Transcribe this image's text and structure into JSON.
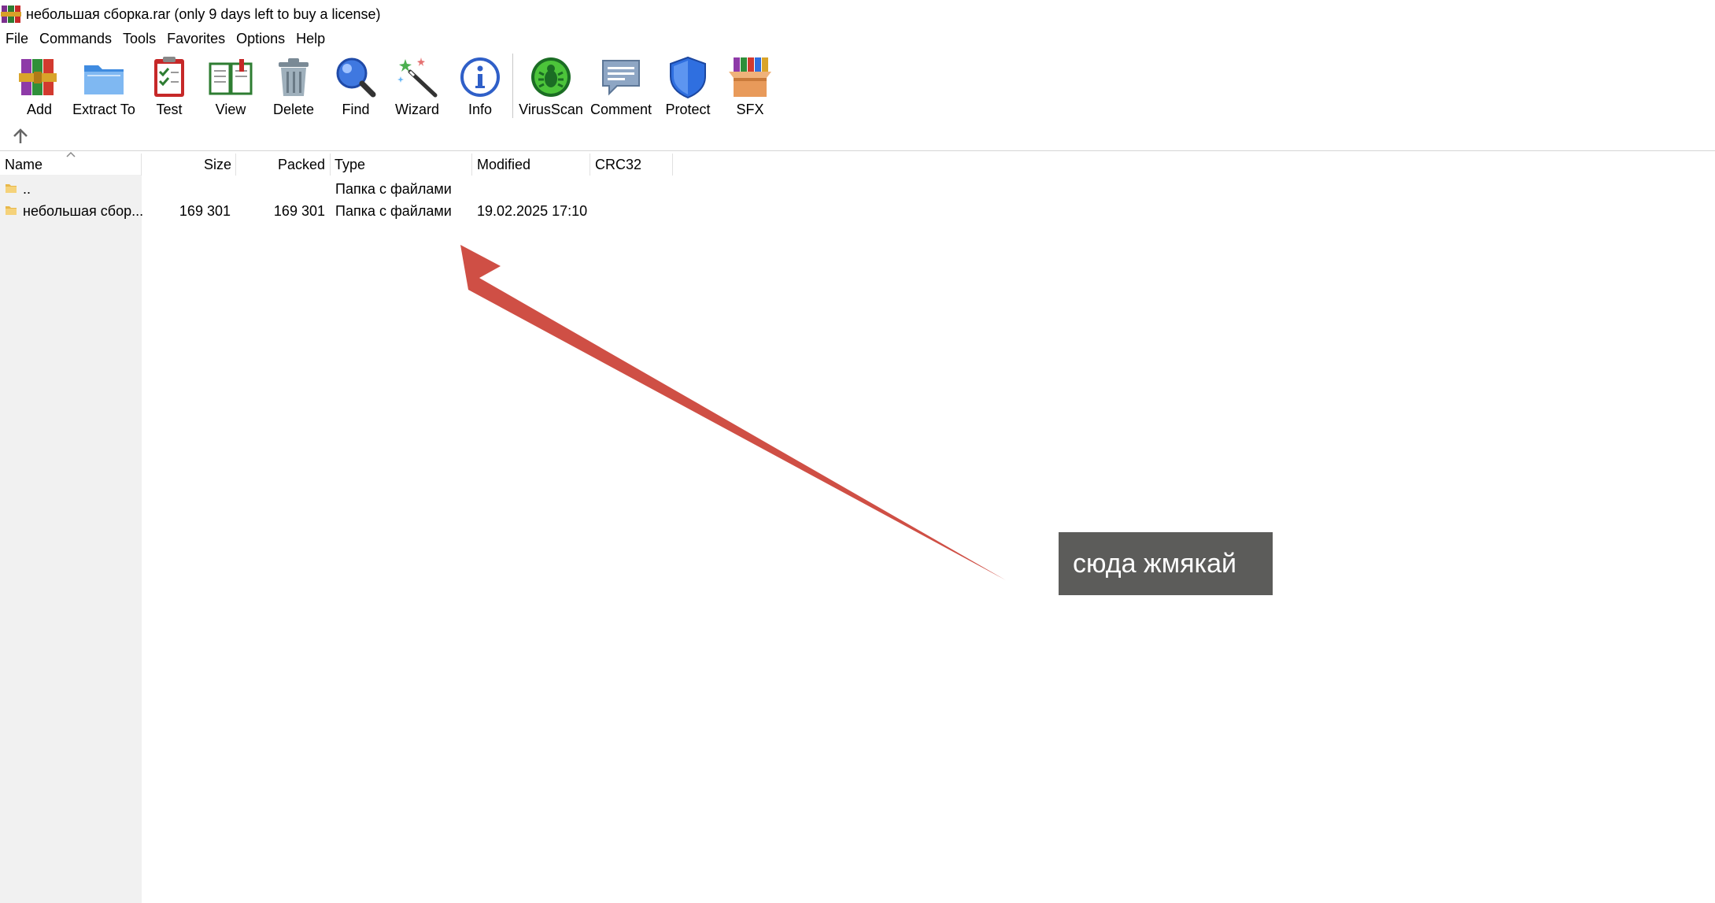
{
  "window": {
    "title": "небольшая сборка.rar (only 9 days left to buy a license)"
  },
  "menu": [
    "File",
    "Commands",
    "Tools",
    "Favorites",
    "Options",
    "Help"
  ],
  "toolbar": {
    "add": "Add",
    "extract_to": "Extract To",
    "test": "Test",
    "view": "View",
    "delete": "Delete",
    "find": "Find",
    "wizard": "Wizard",
    "info": "Info",
    "virusscan": "VirusScan",
    "comment": "Comment",
    "protect": "Protect",
    "sfx": "SFX"
  },
  "columns": {
    "name": "Name",
    "size": "Size",
    "packed": "Packed",
    "type": "Type",
    "modified": "Modified",
    "crc32": "CRC32"
  },
  "rows": [
    {
      "name": "..",
      "size": "",
      "packed": "",
      "type": "Папка с файлами",
      "modified": ""
    },
    {
      "name": "небольшая сбор...",
      "size": "169 301",
      "packed": "169 301",
      "type": "Папка с файлами",
      "modified": "19.02.2025 17:10"
    }
  ],
  "annotation": {
    "text": "сюда жмякай",
    "arrow_color": "#cf4f45",
    "box_color": "#5c5c5a"
  }
}
